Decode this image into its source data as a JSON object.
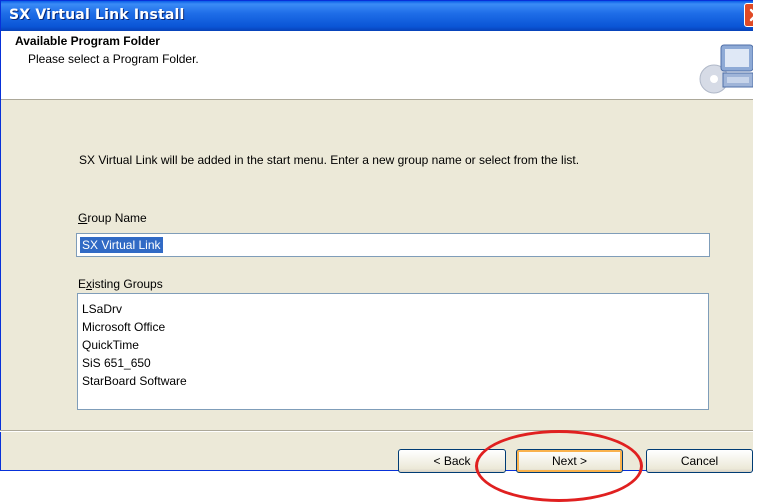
{
  "window": {
    "title": "SX Virtual Link Install"
  },
  "header": {
    "title": "Available Program Folder",
    "subtitle": "Please select a Program Folder.",
    "icon": "computer-install-icon"
  },
  "body": {
    "intro": "SX Virtual Link will be added in the start menu. Enter a new group name  or select from the list.",
    "group_name_label": "Group Name",
    "group_name_value": "SX Virtual Link",
    "existing_groups_label": "Existing Groups",
    "existing_groups": [
      "LSaDrv",
      "Microsoft Office",
      "QuickTime",
      "SiS 651_650",
      "StarBoard Software"
    ]
  },
  "buttons": {
    "back": "< Back",
    "next": "Next >",
    "cancel": "Cancel"
  },
  "colors": {
    "titlebar": "#0a55d6",
    "close": "#e04a26",
    "highlight": "#e02020",
    "selection": "#316ac5"
  }
}
